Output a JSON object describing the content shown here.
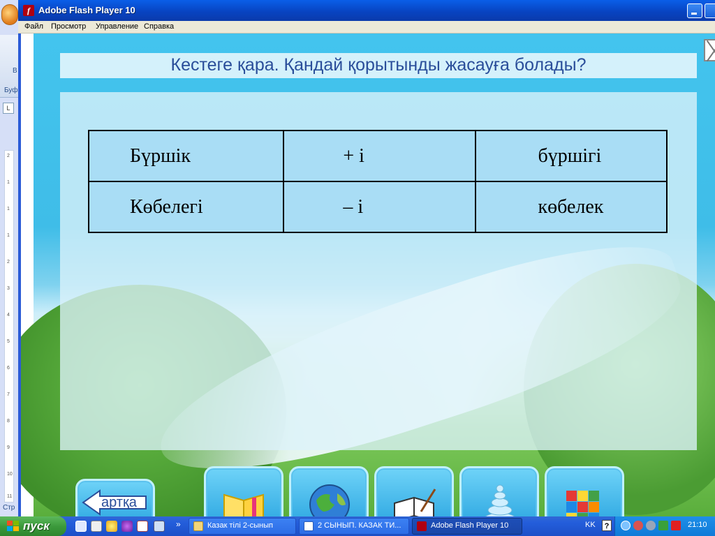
{
  "word_window": {
    "ribbon_char": "В",
    "ribbon_group": "Буф",
    "ruler_button": "L",
    "status": "Стр",
    "ruler_numbers": [
      "2",
      "1",
      "1",
      "1",
      "2",
      "3",
      "4",
      "5",
      "6",
      "7",
      "8",
      "9",
      "10",
      "11"
    ]
  },
  "flash_window": {
    "title": "Adobe Flash Player 10",
    "icon_glyph": "f",
    "menu": [
      "Файл",
      "Просмотр",
      "Управление",
      "Справка"
    ]
  },
  "lesson": {
    "question": "Кестеге қара. Қандай қорытынды жасауға болады?",
    "table": [
      [
        "Бүршік",
        "+ і",
        "бүршігі"
      ],
      [
        "Көбелегі",
        "– і",
        "көбелек"
      ]
    ],
    "back_button_label": "артқа",
    "nav_icons": [
      "book-icon",
      "globe-icon",
      "notebook-pen-icon",
      "pyramid-toy-icon",
      "rubiks-cube-icon"
    ]
  },
  "taskbar": {
    "start_label": "пуск",
    "chevron": "»",
    "tasks": [
      {
        "label": "Казак тілі 2-сынып",
        "icon": "folder-icon",
        "active": false
      },
      {
        "label": "2 СЫНЫП. КАЗАК ТИ...",
        "icon": "word-document-icon",
        "active": false
      },
      {
        "label": "Adobe Flash Player 10",
        "icon": "flash-player-icon",
        "active": true
      }
    ],
    "language": "KK",
    "help_glyph": "?",
    "clock": "21:10"
  },
  "colors": {
    "title_text": "#2a4e9a",
    "table_fill": "#a9ddf5",
    "titlebar": "#0a5fe8",
    "start_green": "#3c9a3c"
  }
}
